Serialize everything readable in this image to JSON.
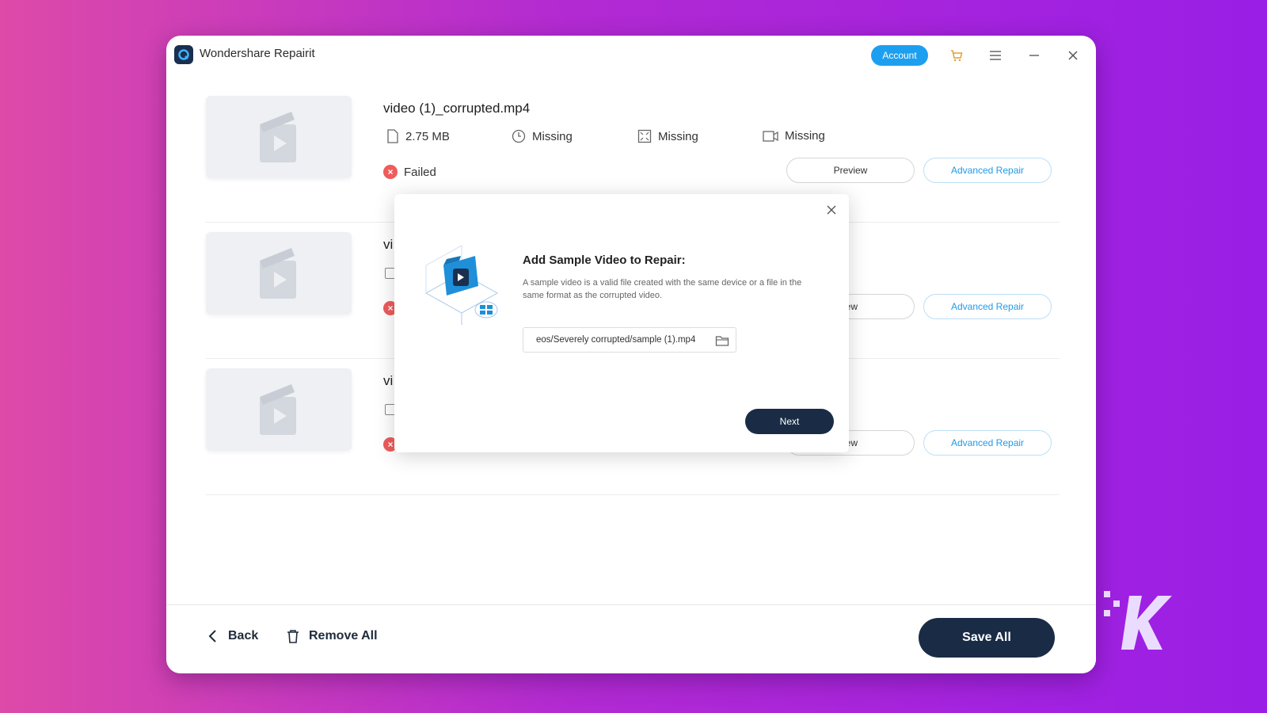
{
  "window": {
    "title": "Wondershare Repairit",
    "account_label": "Account"
  },
  "files": [
    {
      "name": "video (1)_corrupted.mp4",
      "size": "2.75  MB",
      "duration": "Missing",
      "resolution": "Missing",
      "format": "Missing",
      "status": "Failed",
      "preview_label": "Preview",
      "advanced_label": "Advanced Repair"
    },
    {
      "name": "vi",
      "preview_label": "iew",
      "advanced_label": "Advanced Repair"
    },
    {
      "name": "vi",
      "preview_label": "iew",
      "advanced_label": "Advanced Repair"
    }
  ],
  "dialog": {
    "title": "Add Sample Video to Repair:",
    "description": "A sample video is a valid file created with the same device or a file in the same format as the corrupted video.",
    "path_value": "eos/Severely corrupted/sample (1).mp4",
    "next_label": "Next"
  },
  "bottom": {
    "back_label": "Back",
    "remove_all_label": "Remove All",
    "save_all_label": "Save All"
  },
  "colors": {
    "accent": "#1d9ff0",
    "dark_button": "#1a2c45",
    "failed": "#ef5b5b"
  },
  "icons": [
    "app-logo-icon",
    "cart-icon",
    "menu-icon",
    "minimize-icon",
    "close-icon",
    "file-icon",
    "clock-icon",
    "resolution-icon",
    "video-format-icon",
    "failed-icon",
    "folder-icon",
    "back-arrow-icon",
    "trash-icon",
    "clapperboard-icon"
  ]
}
